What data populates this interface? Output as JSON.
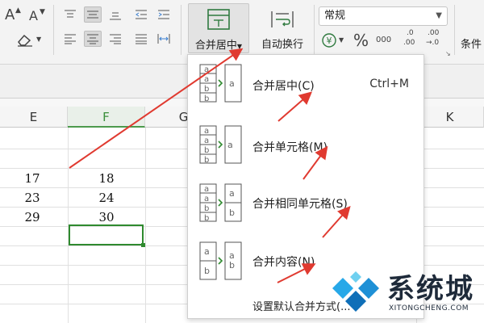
{
  "ribbon": {
    "font_grow": "A",
    "font_shrink": "A",
    "clear_format": "⌂",
    "merge_label": "合并居中",
    "wrap_label": "自动换行",
    "number_format": "常规",
    "percent": "%",
    "thousands": "000",
    "decimal_add_top": ".0",
    "decimal_add_bottom": ".00",
    "decimal_remove_top": ".00",
    "decimal_remove_bottom": "→.0",
    "conditional_label": "条件"
  },
  "columns": {
    "e": "E",
    "f": "F",
    "g": "G",
    "k": "K"
  },
  "cells": {
    "e_row1": "17",
    "f_row1": "18",
    "e_row2": "23",
    "f_row2": "24",
    "e_row3": "29",
    "f_row3": "30"
  },
  "menu": {
    "items": [
      {
        "label": "合并居中(C)",
        "shortcut": "Ctrl+M"
      },
      {
        "label": "合并单元格(M)"
      },
      {
        "label": "合并相同单元格(S)"
      },
      {
        "label": "合并内容(N)"
      }
    ],
    "set_default_label": "设置默认合并方式(...",
    "icon_letters": {
      "a": "a",
      "b": "b"
    }
  },
  "watermark": {
    "title": "系统城",
    "subtitle": "XITONGCHENG.COM"
  },
  "colors": {
    "accent_green": "#2f8a2f",
    "arrow_red": "#e03a30",
    "watermark_blue": "#1e90d6"
  }
}
